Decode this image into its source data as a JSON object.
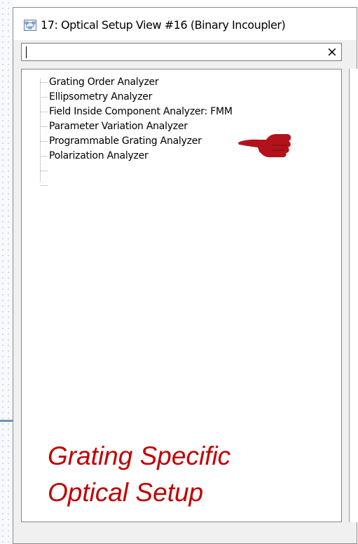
{
  "window": {
    "title": "17: Optical Setup View #16 (Binary Incoupler)",
    "icon": "optical-setup-view-icon"
  },
  "search": {
    "value": "",
    "placeholder": "",
    "clear_label": "×",
    "clear_icon": "close-icon"
  },
  "tree": {
    "items": [
      {
        "label": "Grating Order Analyzer"
      },
      {
        "label": "Ellipsometry Analyzer"
      },
      {
        "label": "Field Inside Component Analyzer: FMM"
      },
      {
        "label": "Parameter Variation Analyzer"
      },
      {
        "label": "Programmable Grating Analyzer"
      },
      {
        "label": "Polarization Analyzer"
      }
    ]
  },
  "annotation": {
    "caption_line1": "Grating Specific",
    "caption_line2": "Optical Setup",
    "pointer_icon": "pointing-hand-icon",
    "pointed_item": "Parameter Variation Analyzer",
    "color": "#c00000"
  }
}
